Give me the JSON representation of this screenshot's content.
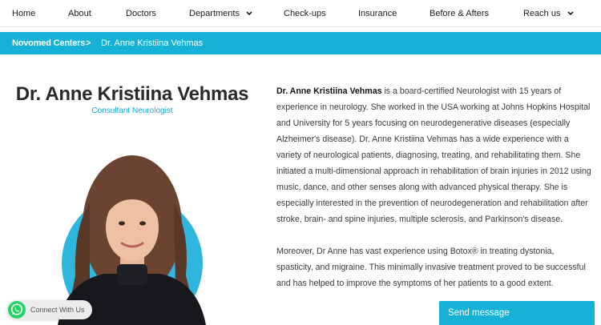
{
  "nav": {
    "items": [
      {
        "label": "Home"
      },
      {
        "label": "About"
      },
      {
        "label": "Doctors"
      },
      {
        "label": "Departments"
      },
      {
        "label": "Check-ups"
      },
      {
        "label": "Insurance"
      },
      {
        "label": "Before & Afters"
      },
      {
        "label": "Reach us"
      }
    ]
  },
  "breadcrumb": {
    "parent": "Novomed Centers",
    "separator": ">",
    "current": "Dr. Anne Kristiina Vehmas"
  },
  "doctor": {
    "name": "Dr. Anne Kristiina Vehmas",
    "title": "Consultant Neurologist"
  },
  "bio": {
    "p1_name": "Dr. Anne Kristiina Vehmas",
    "p1_text": " is a board-certified Neurologist with 15 years of experience in neurology. She worked in the USA working at Johns Hopkins Hospital and University for 5 years focusing on neurodegenerative diseases (especially Alzheimer's disease). Dr. Anne Kristiina Vehmas has a wide experience with a variety of neurological patients, diagnosing, treating, and rehabilitating them. She initiated a multi-dimensional approach in rehabilitation of brain injuries in 2012 using music, dance, and other senses along with advanced physical therapy.  She is especially interested in the prevention of neurodegeneration and rehabilitation after stroke, brain- and spine injuries, multiple sclerosis, and Parkinson's disease.",
    "p2_text": "Moreover, Dr Anne has vast experience using Botox® in treating dystonia, spasticity, and migraine.  This minimally invasive treatment proved to be successful and has helped to improve the symptoms of her patients to a good extent."
  },
  "widgets": {
    "whatsapp_label": "Connect With Us",
    "send_message_label": "Send message"
  },
  "colors": {
    "accent": "#16b1d6",
    "accent_text": "#16a8cf",
    "whatsapp": "#25d366"
  },
  "icons": {
    "dropdown": "chevron-down-icon",
    "whatsapp": "whatsapp-icon"
  }
}
